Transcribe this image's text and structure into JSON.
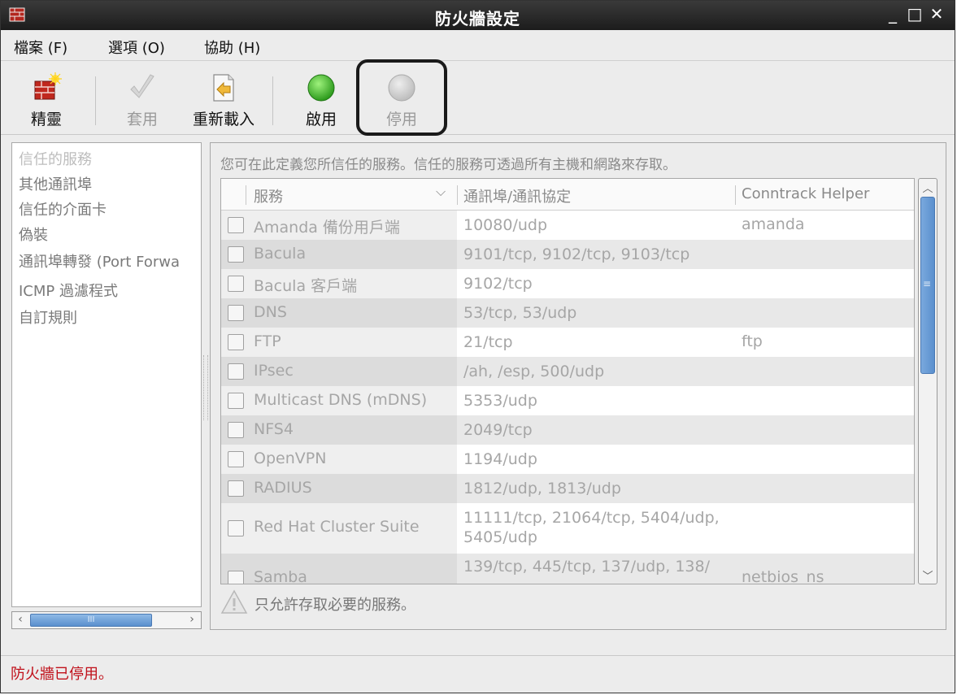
{
  "window": {
    "title": "防火牆設定",
    "controls": [
      "_",
      "□",
      "✕"
    ]
  },
  "menu": [
    {
      "label": "檔案 (F)"
    },
    {
      "label": "選項 (O)"
    },
    {
      "label": "協助 (H)"
    }
  ],
  "toolbar": {
    "wizard_label": "精靈",
    "apply_label": "套用",
    "reload_label": "重新載入",
    "enable_label": "啟用",
    "disable_label": "停用",
    "enable_color": "#36b02a",
    "disable_color": "#c8c8c8"
  },
  "nav": {
    "items": [
      {
        "label": "信任的服務",
        "selected": true
      },
      {
        "label": "其他通訊埠"
      },
      {
        "label": "信任的介面卡"
      },
      {
        "label": "偽裝"
      },
      {
        "label": "通訊埠轉發 (Port Forwa"
      },
      {
        "label": "ICMP 過濾程式"
      },
      {
        "label": "自訂規則"
      }
    ],
    "hscroll_grip": "III"
  },
  "panel": {
    "description": "您可在此定義您所信任的服務。信任的服務可透過所有主機和網路來存取。",
    "columns": {
      "service": "服務",
      "port": "通訊埠/通訊協定",
      "helper": "Conntrack Helper"
    },
    "sort_indicator": "⌵",
    "rows": [
      {
        "name": "Amanda 備份用戶端",
        "port": "10080/udp",
        "helper": "amanda"
      },
      {
        "name": "Bacula",
        "port": "9101/tcp, 9102/tcp, 9103/tcp",
        "helper": ""
      },
      {
        "name": "Bacula 客戶端",
        "port": "9102/tcp",
        "helper": ""
      },
      {
        "name": "DNS",
        "port": "53/tcp, 53/udp",
        "helper": ""
      },
      {
        "name": "FTP",
        "port": "21/tcp",
        "helper": "ftp"
      },
      {
        "name": "IPsec",
        "port": "/ah, /esp, 500/udp",
        "helper": ""
      },
      {
        "name": "Multicast DNS (mDNS)",
        "port": "5353/udp",
        "helper": ""
      },
      {
        "name": "NFS4",
        "port": "2049/tcp",
        "helper": ""
      },
      {
        "name": "OpenVPN",
        "port": "1194/udp",
        "helper": ""
      },
      {
        "name": "RADIUS",
        "port": "1812/udp, 1813/udp",
        "helper": ""
      },
      {
        "name": "Red Hat Cluster Suite",
        "port": "11111/tcp, 21064/tcp, 5404/udp,",
        "port2": "5405/udp",
        "helper": ""
      },
      {
        "name": "Samba",
        "port": "139/tcp, 445/tcp, 137/udp, 138/",
        "helper": "netbios_ns"
      }
    ],
    "note": "只允許存取必要的服務。",
    "vscroll_grip": "≡"
  },
  "status": {
    "text": "防火牆已停用。",
    "color": "#c0101a"
  }
}
